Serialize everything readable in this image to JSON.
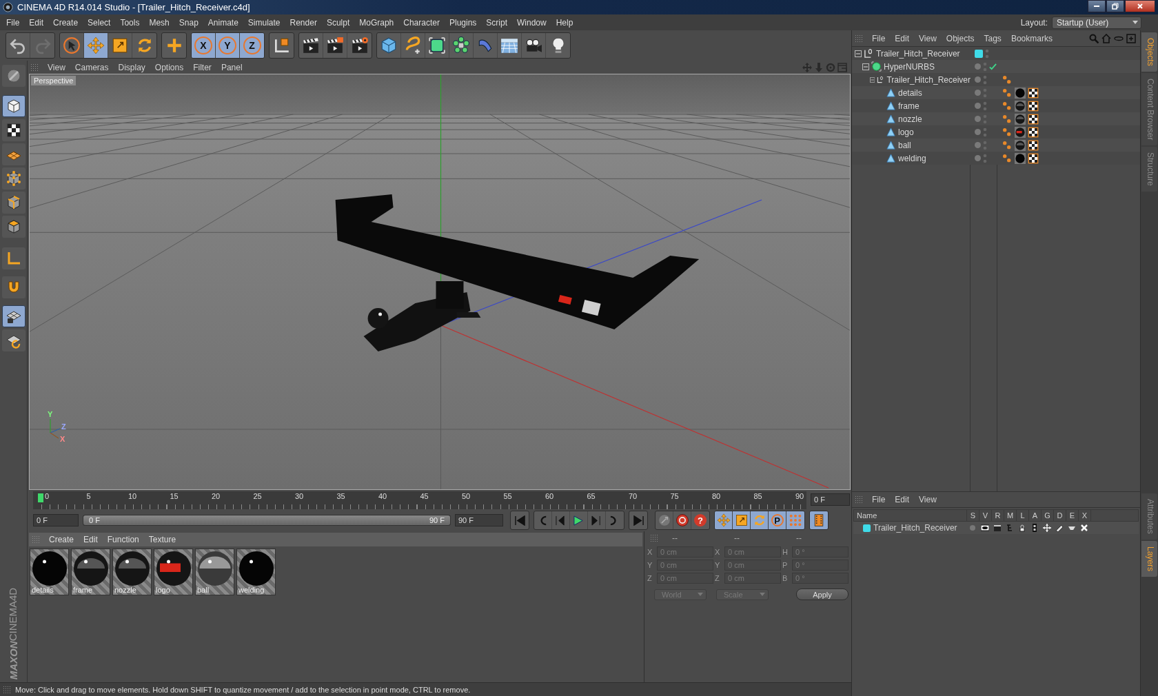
{
  "window": {
    "title": "CINEMA 4D R14.014 Studio - [Trailer_Hitch_Receiver.c4d]"
  },
  "menu": [
    "File",
    "Edit",
    "Create",
    "Select",
    "Tools",
    "Mesh",
    "Snap",
    "Animate",
    "Simulate",
    "Render",
    "Sculpt",
    "MoGraph",
    "Character",
    "Plugins",
    "Script",
    "Window",
    "Help"
  ],
  "layout": {
    "label": "Layout:",
    "value": "Startup (User)"
  },
  "toolbar": [
    {
      "kind": "undo",
      "selected": false
    },
    {
      "kind": "redo",
      "selected": false
    },
    {
      "kind": "select",
      "selected": false
    },
    {
      "kind": "move",
      "selected": true
    },
    {
      "kind": "scale",
      "selected": false
    },
    {
      "kind": "rotate",
      "selected": false
    },
    {
      "kind": "add",
      "selected": false
    },
    {
      "kind": "axis",
      "label": "X",
      "selected": true
    },
    {
      "kind": "axis",
      "label": "Y",
      "selected": true
    },
    {
      "kind": "axis",
      "label": "Z",
      "selected": true
    },
    {
      "kind": "coords",
      "selected": false
    },
    {
      "kind": "render-view",
      "selected": false
    },
    {
      "kind": "render-pv",
      "selected": false
    },
    {
      "kind": "render-settings",
      "selected": false
    },
    {
      "kind": "cube",
      "selected": false
    },
    {
      "kind": "spline",
      "selected": false
    },
    {
      "kind": "nurbs",
      "selected": false
    },
    {
      "kind": "array",
      "selected": false
    },
    {
      "kind": "deformer",
      "selected": false
    },
    {
      "kind": "floor",
      "selected": false
    },
    {
      "kind": "camera",
      "selected": false
    },
    {
      "kind": "light",
      "selected": false
    }
  ],
  "side_tools": [
    {
      "kind": "sculpt",
      "selected": false
    },
    {
      "kind": "model",
      "selected": true
    },
    {
      "kind": "texture",
      "selected": false
    },
    {
      "kind": "workplane",
      "selected": false
    },
    {
      "kind": "points",
      "selected": false
    },
    {
      "kind": "edges",
      "selected": false
    },
    {
      "kind": "polygons",
      "selected": false
    },
    {
      "kind": "axis",
      "selected": false
    },
    {
      "kind": "magnet",
      "selected": false
    },
    {
      "kind": "snap-grid",
      "selected": true
    },
    {
      "kind": "snap-rotate",
      "selected": false
    }
  ],
  "brand": [
    "MAXON",
    "CINEMA4D"
  ],
  "viewport": {
    "menu": [
      "View",
      "Cameras",
      "Display",
      "Options",
      "Filter",
      "Panel"
    ],
    "camera": "Perspective",
    "gizmo_labels": [
      "Y",
      "Z",
      "X"
    ]
  },
  "objects": {
    "menu": [
      "File",
      "Edit",
      "View",
      "Objects",
      "Tags",
      "Bookmarks"
    ],
    "tree": [
      {
        "name": "Trailer_Hitch_Receiver",
        "kind": "null",
        "expanded": true,
        "color": "#3fdbe8",
        "children": [
          {
            "name": "HyperNURBS",
            "kind": "nurbs",
            "expanded": true,
            "enabled": true,
            "children": [
              {
                "name": "Trailer_Hitch_Receiver",
                "kind": "null",
                "expanded": true,
                "tags": [
                  {
                    "kind": "phong"
                  }
                ],
                "children": [
                  {
                    "name": "details",
                    "kind": "polygon",
                    "tags": [
                      {
                        "kind": "phong"
                      },
                      {
                        "kind": "matte"
                      },
                      {
                        "kind": "uvw"
                      }
                    ]
                  },
                  {
                    "name": "frame",
                    "kind": "polygon",
                    "tags": [
                      {
                        "kind": "phong"
                      },
                      {
                        "kind": "glossy"
                      },
                      {
                        "kind": "uvw"
                      }
                    ]
                  },
                  {
                    "name": "nozzle",
                    "kind": "polygon",
                    "tags": [
                      {
                        "kind": "phong"
                      },
                      {
                        "kind": "glossy"
                      },
                      {
                        "kind": "uvw"
                      }
                    ]
                  },
                  {
                    "name": "logo",
                    "kind": "polygon",
                    "tags": [
                      {
                        "kind": "phong"
                      },
                      {
                        "kind": "logo"
                      },
                      {
                        "kind": "uvw"
                      }
                    ]
                  },
                  {
                    "name": "ball",
                    "kind": "polygon",
                    "tags": [
                      {
                        "kind": "phong"
                      },
                      {
                        "kind": "glossy"
                      },
                      {
                        "kind": "uvw"
                      }
                    ]
                  },
                  {
                    "name": "welding",
                    "kind": "polygon",
                    "tags": [
                      {
                        "kind": "phong"
                      },
                      {
                        "kind": "matte"
                      },
                      {
                        "kind": "uvw"
                      }
                    ]
                  }
                ]
              }
            ]
          }
        ]
      }
    ]
  },
  "side_tabs": {
    "top": [
      {
        "label": "Objects",
        "selected": true
      },
      {
        "label": "Content Browser",
        "selected": false
      },
      {
        "label": "Structure",
        "selected": false
      }
    ],
    "bottom": [
      {
        "label": "Attributes",
        "selected": false
      },
      {
        "label": "Layers",
        "selected": true
      }
    ]
  },
  "timeline": {
    "ticks": [
      "0",
      "5",
      "10",
      "15",
      "20",
      "25",
      "30",
      "35",
      "40",
      "45",
      "50",
      "55",
      "60",
      "65",
      "70",
      "75",
      "80",
      "85",
      "90"
    ],
    "frame": "0 F",
    "start": "0 F",
    "range": {
      "start": "0 F",
      "end": "90 F",
      "level": 1
    },
    "end": "90 F"
  },
  "record_tools": [
    {
      "kind": "keyframe"
    },
    {
      "kind": "record"
    },
    {
      "kind": "help",
      "label": "?"
    }
  ],
  "anim_tools": [
    {
      "kind": "move",
      "selected": true
    },
    {
      "kind": "scale",
      "selected": true
    },
    {
      "kind": "rotate",
      "selected": true
    },
    {
      "kind": "param",
      "label": "P",
      "selected": true
    },
    {
      "kind": "points",
      "selected": true
    },
    {
      "kind": "film",
      "selected": true
    }
  ],
  "materials": {
    "menu": [
      "Create",
      "Edit",
      "Function",
      "Texture"
    ],
    "items": [
      {
        "name": "details",
        "kind": "matte"
      },
      {
        "name": "frame",
        "kind": "glossy"
      },
      {
        "name": "nozzle",
        "kind": "glossy"
      },
      {
        "name": "logo",
        "kind": "logo"
      },
      {
        "name": "ball",
        "kind": "chrome"
      },
      {
        "name": "welding",
        "kind": "matte"
      }
    ]
  },
  "coords": {
    "headers": [
      "--",
      "--",
      "--"
    ],
    "rows": [
      {
        "axis": "X",
        "position": "0 cm",
        "size_axis": "X",
        "size": "0 cm",
        "rot_axis": "H",
        "rotation": "0 °"
      },
      {
        "axis": "Y",
        "position": "0 cm",
        "size_axis": "Y",
        "size": "0 cm",
        "rot_axis": "P",
        "rotation": "0 °"
      },
      {
        "axis": "Z",
        "position": "0 cm",
        "size_axis": "Z",
        "size": "0 cm",
        "rot_axis": "B",
        "rotation": "0 °"
      }
    ],
    "mode": "World",
    "size_mode": "Scale",
    "apply": "Apply"
  },
  "layers": {
    "menu": [
      "File",
      "Edit",
      "View"
    ],
    "columns": [
      "Name",
      "S",
      "V",
      "R",
      "M",
      "L",
      "A",
      "G",
      "D",
      "E",
      "X"
    ],
    "rows": [
      {
        "name": "Trailer_Hitch_Receiver",
        "color": "#3fdbe8"
      }
    ]
  },
  "status": "Move: Click and drag to move elements. Hold down SHIFT to quantize movement / add to the selection in point mode, CTRL to remove."
}
